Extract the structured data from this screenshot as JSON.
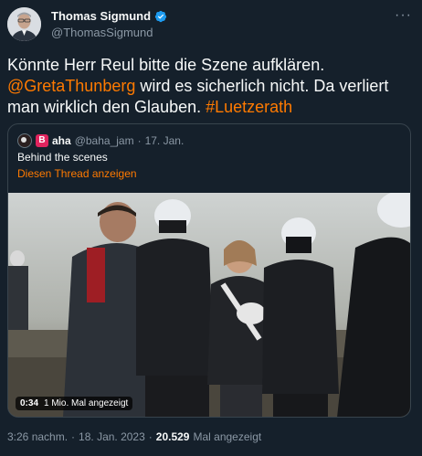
{
  "author": {
    "name": "Thomas Sigmund",
    "handle": "@ThomasSigmund"
  },
  "more_icon": "more-icon",
  "tweet": {
    "text_before": "Könnte Herr Reul bitte die Szene aufklären.",
    "mention": "@GretaThunberg",
    "text_middle": " wird es sicherlich nicht. Da verliert man wirklich den Glauben. ",
    "hashtag": "#Luetzerath"
  },
  "quote": {
    "name_badge": "B",
    "name": "aha",
    "handle": "@baha_jam",
    "sep": "·",
    "date": "17. Jan.",
    "text": "Behind the scenes",
    "thread_link": "Diesen Thread anzeigen",
    "video": {
      "duration": "0:34",
      "views": "1 Mio. Mal angezeigt"
    }
  },
  "footer": {
    "time": "3:26 nachm.",
    "sep": "·",
    "date": "18. Jan. 2023",
    "sep2": "·",
    "views_count": "20.529",
    "views_label": "Mal angezeigt"
  },
  "colors": {
    "background": "#15202b",
    "accent": "#ff7a00",
    "verified": "#1d9bf0",
    "muted": "#8b98a5"
  }
}
